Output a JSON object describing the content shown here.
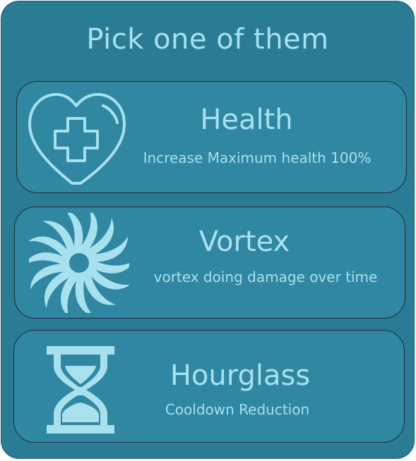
{
  "title": "Pick one of them",
  "colors": {
    "panel": "#2a7b94",
    "card": "#2f87a1",
    "text": "#a8e1ee",
    "icon": "#a8e1ee"
  },
  "options": [
    {
      "name": "Health",
      "description": "Increase Maximum health 100%",
      "icon": "heart-plus-icon"
    },
    {
      "name": "Vortex",
      "description": "vortex doing damage over time",
      "icon": "vortex-icon"
    },
    {
      "name": "Hourglass",
      "description": "Cooldown Reduction",
      "icon": "hourglass-icon"
    }
  ]
}
